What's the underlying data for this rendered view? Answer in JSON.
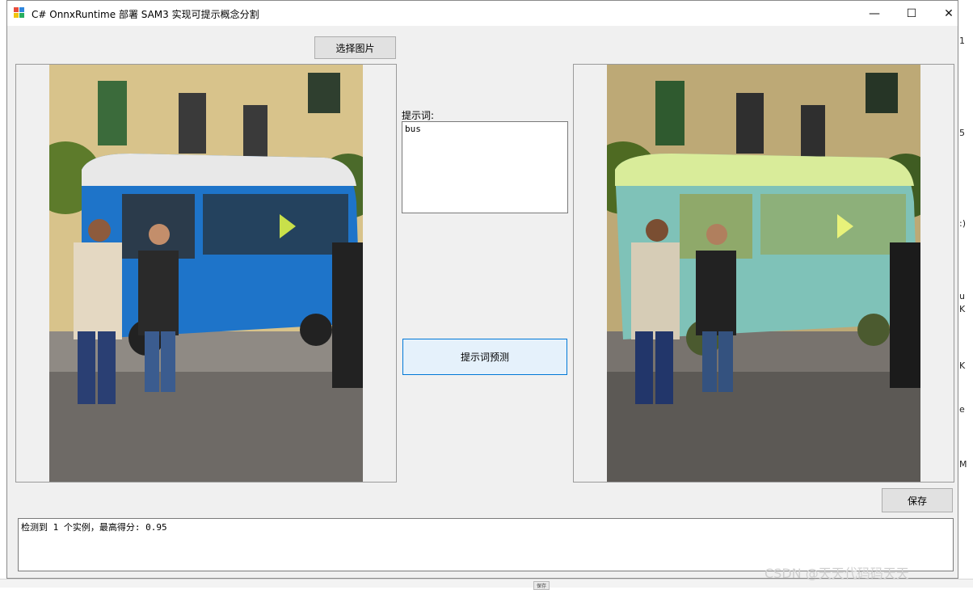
{
  "window": {
    "title": "C# OnnxRuntime 部署 SAM3 实现可提示概念分割",
    "controls": {
      "minimize": "—",
      "maximize": "☐",
      "close": "✕"
    }
  },
  "toolbar": {
    "select_image_label": "选择图片"
  },
  "prompt": {
    "label": "提示词:",
    "value": "bus"
  },
  "predict_button_label": "提示词预测",
  "save_button_label": "保存",
  "status": {
    "text": "检测到 1 个实例，最高得分: 0.95"
  },
  "images": {
    "input": {
      "icon": "photo-street-bus"
    },
    "output": {
      "icon": "photo-street-bus-segmented",
      "mask_color": "#c8e68a"
    }
  },
  "background": {
    "right_fragments": [
      "1",
      "5",
      ":)",
      "u",
      "K",
      "K",
      "e",
      "M"
    ],
    "taskbar_button": "保存"
  },
  "watermark": "CSDN @天天代码码天天",
  "colors": {
    "accent": "#0078d7",
    "window_bg": "#f0f0f0"
  }
}
